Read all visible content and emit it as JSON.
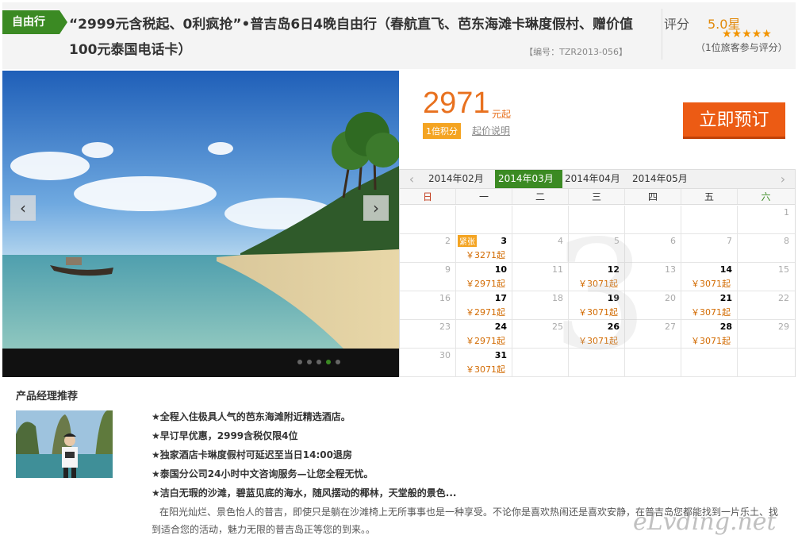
{
  "header": {
    "tag": "自由行",
    "title": "“2999元含税起、0利疯抢”•普吉岛6日4晚自由行（春航直飞、芭东海滩卡琳度假村、赠价值100元泰国电话卡）",
    "code": "【编号：TZR2013-056】",
    "rating_label": "评分",
    "rating_value": "5.0星",
    "stars": "★★★★★",
    "reviews": "（1位旅客参与评分）"
  },
  "banner": {
    "prev": "‹",
    "next": "›",
    "dots": 5,
    "active_dot": 3
  },
  "price": {
    "amount": "2971",
    "unit": "元起",
    "points": "1倍积分",
    "note": "起价说明",
    "book_label": "立即预订"
  },
  "calendar": {
    "prev": "‹",
    "next": "›",
    "months": [
      "2014年02月",
      "2014年03月",
      "2014年04月",
      "2014年05月"
    ],
    "active_month": 1,
    "weekdays": [
      "日",
      "一",
      "二",
      "三",
      "四",
      "五",
      "六"
    ],
    "watermark": "3",
    "weeks": [
      [
        {
          "d": ""
        },
        {
          "d": ""
        },
        {
          "d": ""
        },
        {
          "d": ""
        },
        {
          "d": ""
        },
        {
          "d": ""
        },
        {
          "d": "1"
        }
      ],
      [
        {
          "d": "2"
        },
        {
          "d": "3",
          "p": "￥3271起",
          "tag": "紧张"
        },
        {
          "d": "4"
        },
        {
          "d": "5"
        },
        {
          "d": "6"
        },
        {
          "d": "7"
        },
        {
          "d": "8"
        }
      ],
      [
        {
          "d": "9"
        },
        {
          "d": "10",
          "p": "￥2971起"
        },
        {
          "d": "11"
        },
        {
          "d": "12",
          "p": "￥3071起"
        },
        {
          "d": "13"
        },
        {
          "d": "14",
          "p": "￥3071起"
        },
        {
          "d": "15"
        }
      ],
      [
        {
          "d": "16"
        },
        {
          "d": "17",
          "p": "￥2971起"
        },
        {
          "d": "18"
        },
        {
          "d": "19",
          "p": "￥3071起"
        },
        {
          "d": "20"
        },
        {
          "d": "21",
          "p": "￥3071起"
        },
        {
          "d": "22"
        }
      ],
      [
        {
          "d": "23"
        },
        {
          "d": "24",
          "p": "￥2971起"
        },
        {
          "d": "25"
        },
        {
          "d": "26",
          "p": "￥3071起"
        },
        {
          "d": "27"
        },
        {
          "d": "28",
          "p": "￥3071起"
        },
        {
          "d": "29"
        }
      ],
      [
        {
          "d": "30"
        },
        {
          "d": "31",
          "p": "￥3071起"
        },
        {
          "d": ""
        },
        {
          "d": ""
        },
        {
          "d": ""
        },
        {
          "d": ""
        },
        {
          "d": ""
        }
      ]
    ]
  },
  "recommend": {
    "title": "产品经理推荐",
    "items": [
      "★全程入住极具人气的芭东海滩附近精选酒店。",
      "★早订早优惠，2999含税仅限4位",
      "★独家酒店卡琳度假村可延迟至当日14:00退房",
      "★泰国分公司24小时中文咨询服务—让您全程无忧。",
      "★洁白无瑕的沙滩，碧蓝见底的海水，随风摆动的椰林，天堂般的景色..."
    ],
    "description": "在阳光灿烂、景色怡人的普吉，即使只是躺在沙滩椅上无所事事也是一种享受。不论你是喜欢热闹还是喜欢安静，在普吉岛您都能找到一片乐土、找到适合您的活动，魅力无限的普吉岛正等您的到来。。"
  },
  "watermark": "eLvding.net"
}
